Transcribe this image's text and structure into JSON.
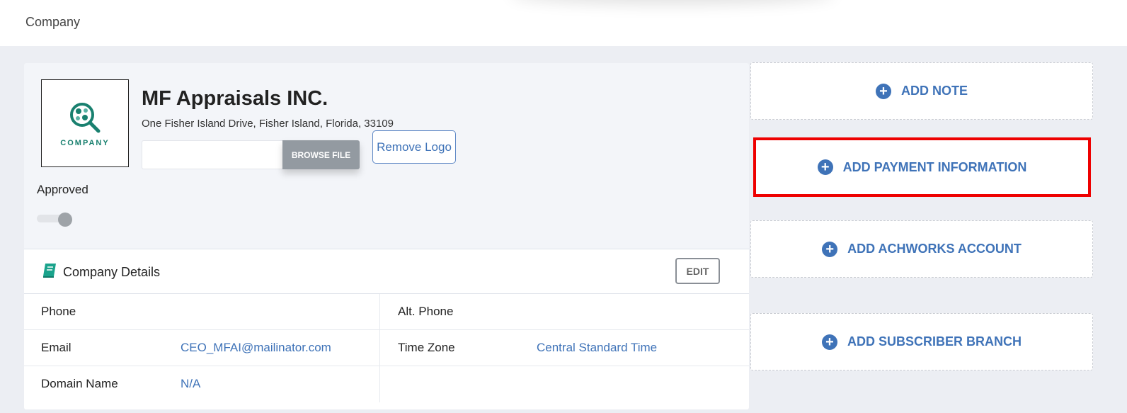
{
  "header": {
    "title": "Company"
  },
  "company": {
    "logo_text": "COMPANY",
    "name": "MF Appraisals INC.",
    "address": "One Fisher Island Drive, Fisher Island, Florida, 33109",
    "browse_label": "BROWSE FILE",
    "remove_logo_label": "Remove Logo",
    "approved_label": "Approved",
    "approved": false
  },
  "details": {
    "title": "Company Details",
    "edit_label": "EDIT",
    "rows": [
      {
        "left_label": "Phone",
        "left_value": "",
        "right_label": "Alt. Phone",
        "right_value": ""
      },
      {
        "left_label": "Email",
        "left_value": "CEO_MFAI@mailinator.com",
        "right_label": "Time Zone",
        "right_value": "Central Standard Time"
      },
      {
        "left_label": "Domain Name",
        "left_value": "N/A",
        "right_label": "",
        "right_value": ""
      }
    ]
  },
  "actions": [
    {
      "label": "ADD NOTE",
      "icon": "plus-circle-icon"
    },
    {
      "label": "ADD PAYMENT INFORMATION",
      "icon": "plus-circle-icon"
    },
    {
      "label": "ADD ACHWORKS ACCOUNT",
      "icon": "plus-circle-icon"
    },
    {
      "label": "ADD SUBSCRIBER BRANCH",
      "icon": "plus-circle-icon"
    }
  ],
  "colors": {
    "accent": "#3f73b8",
    "highlight": "#ee0000",
    "brand_teal": "#19806f"
  }
}
